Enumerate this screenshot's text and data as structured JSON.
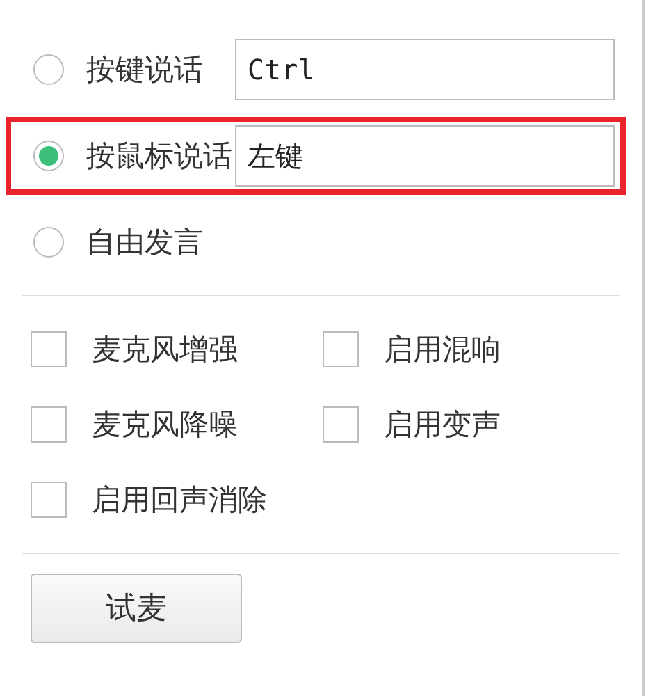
{
  "speak_modes": [
    {
      "label": "按键说话",
      "selected": false,
      "highlighted": false,
      "hotkey": "Ctrl"
    },
    {
      "label": "按鼠标说话",
      "selected": true,
      "highlighted": true,
      "hotkey": "左键"
    },
    {
      "label": "自由发言",
      "selected": false,
      "highlighted": false
    }
  ],
  "options": [
    {
      "label": "麦克风增强",
      "checked": false
    },
    {
      "label": "启用混响",
      "checked": false
    },
    {
      "label": "麦克风降噪",
      "checked": false
    },
    {
      "label": "启用变声",
      "checked": false
    },
    {
      "label": "启用回声消除",
      "checked": false
    }
  ],
  "test_button": "试麦"
}
